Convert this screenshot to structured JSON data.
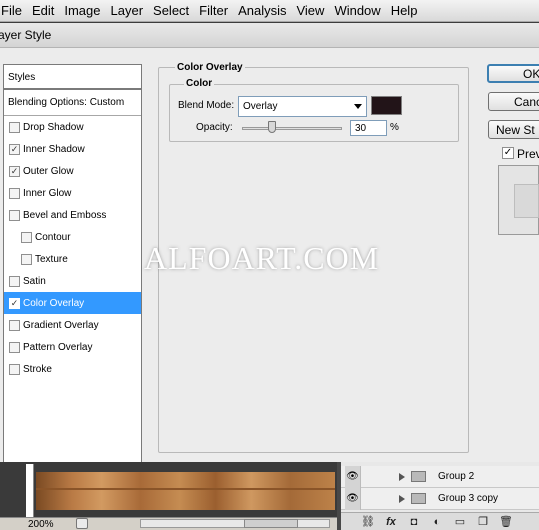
{
  "menubar": {
    "items": [
      "File",
      "Edit",
      "Image",
      "Layer",
      "Select",
      "Filter",
      "Analysis",
      "View",
      "Window",
      "Help"
    ]
  },
  "dialog": {
    "title": "ayer Style",
    "styles_header": "Styles",
    "blending_header": "Blending Options: Custom",
    "style_items": [
      {
        "label": "Drop Shadow",
        "checked": false
      },
      {
        "label": "Inner Shadow",
        "checked": true
      },
      {
        "label": "Outer Glow",
        "checked": true
      },
      {
        "label": "Inner Glow",
        "checked": false
      },
      {
        "label": "Bevel and Emboss",
        "checked": false
      },
      {
        "label": "Contour",
        "checked": false
      },
      {
        "label": "Texture",
        "checked": false
      },
      {
        "label": "Satin",
        "checked": false
      },
      {
        "label": "Color Overlay",
        "checked": true
      },
      {
        "label": "Gradient Overlay",
        "checked": false
      },
      {
        "label": "Pattern Overlay",
        "checked": false
      },
      {
        "label": "Stroke",
        "checked": false
      }
    ],
    "group_title": "Color Overlay",
    "subgroup_title": "Color",
    "blend_mode_label": "Blend Mode:",
    "blend_mode_value": "Overlay",
    "overlay_color": "#221418",
    "opacity_label": "Opacity:",
    "opacity_value": "30",
    "opacity_unit": "%",
    "opacity_fraction": 0.3,
    "buttons": {
      "ok": "OK",
      "cancel": "Canc",
      "new_style": "New St"
    },
    "preview_label": "Prev",
    "preview_checked": true
  },
  "watermark": "ALFOART.COM",
  "statusbar": {
    "zoom": "200%"
  },
  "layers": {
    "rows": [
      {
        "name": "Group 2"
      },
      {
        "name": "Group 3 copy"
      }
    ],
    "toolbar_icons": [
      "link-icon",
      "fx-icon",
      "mask-icon",
      "adjustment-icon",
      "folder-icon",
      "new-layer-icon",
      "trash-icon"
    ]
  },
  "colors": {
    "selected": "#3399ff",
    "dialog_bg": "#ececec"
  }
}
